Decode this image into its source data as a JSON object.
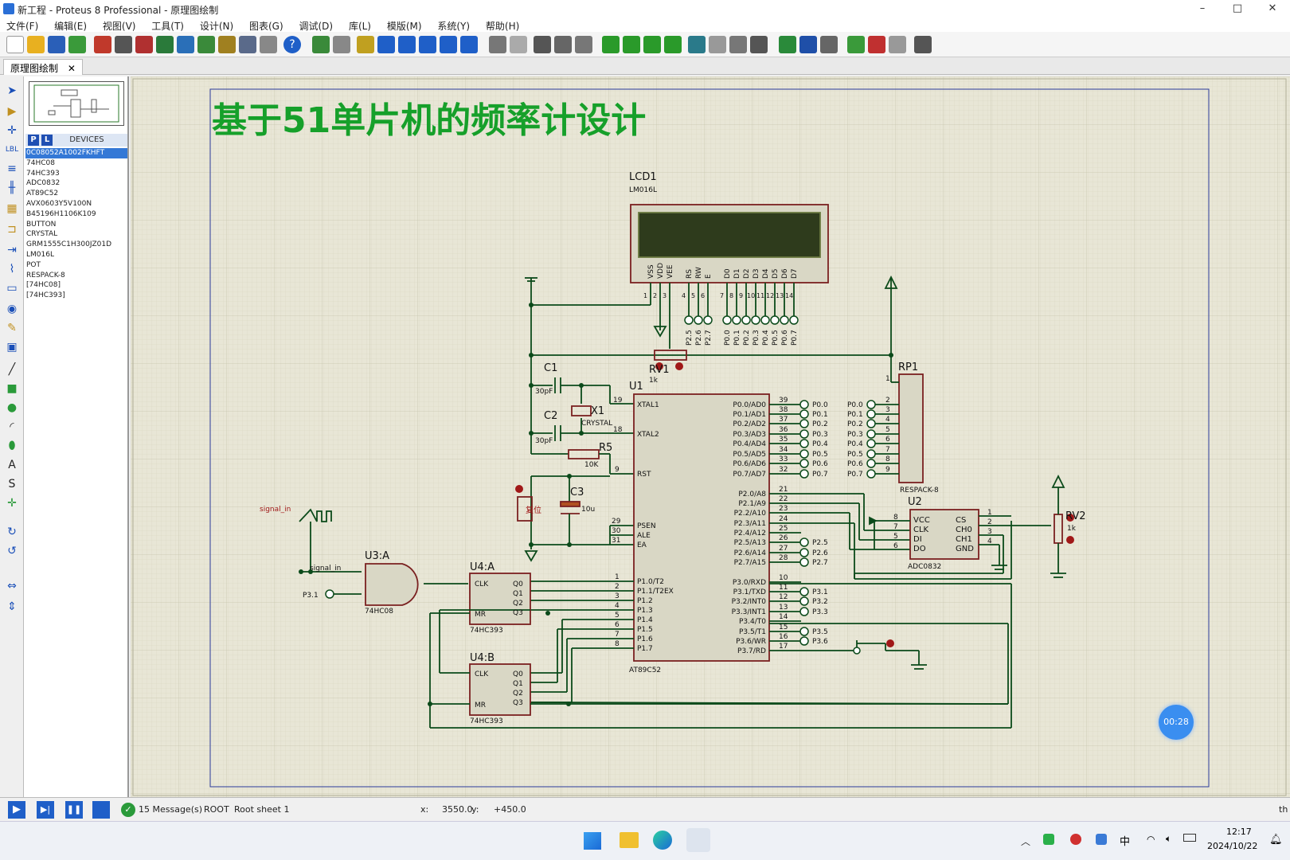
{
  "window": {
    "title": "新工程 - Proteus 8 Professional - 原理图绘制",
    "minimize": "–",
    "maximize": "□",
    "close": "✕"
  },
  "menu": [
    "文件(F)",
    "编辑(E)",
    "视图(V)",
    "工具(T)",
    "设计(N)",
    "图表(G)",
    "调试(D)",
    "库(L)",
    "模版(M)",
    "系统(Y)",
    "帮助(H)"
  ],
  "tab": {
    "label": "原理图绘制",
    "close": "✕"
  },
  "devices": {
    "header": "DEVICES",
    "p_button": "P",
    "l_button": "L",
    "items": [
      "0C08052A1002FKHFT",
      "74HC08",
      "74HC393",
      "ADC0832",
      "AT89C52",
      "AVX0603Y5V100N",
      "B45196H1106K109",
      "BUTTON",
      "CRYSTAL",
      "GRM1555C1H300JZ01D",
      "LM016L",
      "POT",
      "RESPACK-8",
      "[74HC08]",
      "[74HC393]"
    ],
    "selected_index": 0
  },
  "schematic": {
    "title": "基于51单片机的频率计设计",
    "lcd": {
      "ref": "LCD1",
      "part": "LM016L",
      "pins": [
        "VSS",
        "VDD",
        "VEE",
        "RS",
        "RW",
        "E",
        "D0",
        "D1",
        "D2",
        "D3",
        "D4",
        "D5",
        "D6",
        "D7"
      ],
      "pin_nums": [
        "1",
        "2",
        "3",
        "4",
        "5",
        "6",
        "7",
        "8",
        "9",
        "10",
        "11",
        "12",
        "13",
        "14"
      ],
      "labels": [
        "P2.5",
        "P2.6",
        "P2.7",
        "P0.0",
        "P0.1",
        "P0.2",
        "P0.3",
        "P0.4",
        "P0.5",
        "P0.6",
        "P0.7"
      ]
    },
    "rv1": {
      "ref": "RV1",
      "val": "1k"
    },
    "rv2": {
      "ref": "RV2",
      "val": "1k"
    },
    "c1": {
      "ref": "C1",
      "val": "30pF"
    },
    "c2": {
      "ref": "C2",
      "val": "30pF"
    },
    "c3": {
      "ref": "C3",
      "val": "10u"
    },
    "x1": {
      "ref": "X1",
      "part": "CRYSTAL"
    },
    "r5": {
      "ref": "R5",
      "val": "10K"
    },
    "reset_label": "复位",
    "u1": {
      "ref": "U1",
      "part": "AT89C52",
      "left_pins": [
        "XTAL1",
        "XTAL2",
        "RST",
        "PSEN",
        "ALE",
        "EA",
        "P1.0/T2",
        "P1.1/T2EX",
        "P1.2",
        "P1.3",
        "P1.4",
        "P1.5",
        "P1.6",
        "P1.7"
      ],
      "left_nums": [
        "19",
        "18",
        "9",
        "29",
        "30",
        "31",
        "1",
        "2",
        "3",
        "4",
        "5",
        "6",
        "7",
        "8"
      ],
      "right_pins": [
        "P0.0/AD0",
        "P0.1/AD1",
        "P0.2/AD2",
        "P0.3/AD3",
        "P0.4/AD4",
        "P0.5/AD5",
        "P0.6/AD6",
        "P0.7/AD7",
        "P2.0/A8",
        "P2.1/A9",
        "P2.2/A10",
        "P2.3/A11",
        "P2.4/A12",
        "P2.5/A13",
        "P2.6/A14",
        "P2.7/A15",
        "P3.0/RXD",
        "P3.1/TXD",
        "P3.2/INT0",
        "P3.3/INT1",
        "P3.4/T0",
        "P3.5/T1",
        "P3.6/WR",
        "P3.7/RD"
      ],
      "right_nums": [
        "39",
        "38",
        "37",
        "36",
        "35",
        "34",
        "33",
        "32",
        "21",
        "22",
        "23",
        "24",
        "25",
        "26",
        "27",
        "28",
        "10",
        "11",
        "12",
        "13",
        "14",
        "15",
        "16",
        "17"
      ],
      "port_labels": [
        "P0.0",
        "P0.1",
        "P0.2",
        "P0.3",
        "P0.4",
        "P0.5",
        "P0.6",
        "P0.7"
      ],
      "p2_labels": [
        "P2.5",
        "P2.6",
        "P2.7"
      ],
      "p3_labels": [
        "P3.1",
        "P3.2",
        "P3.3",
        "P3.5",
        "P3.6"
      ]
    },
    "rp1": {
      "ref": "RP1",
      "part": "RESPACK-8",
      "labels": [
        "P0.0",
        "P0.1",
        "P0.2",
        "P0.3",
        "P0.4",
        "P0.5",
        "P0.6",
        "P0.7"
      ],
      "nums": [
        "1",
        "2",
        "3",
        "4",
        "5",
        "6",
        "7",
        "8",
        "9"
      ]
    },
    "u2": {
      "ref": "U2",
      "part": "ADC0832",
      "left": [
        "VCC",
        "CLK",
        "DI",
        "DO"
      ],
      "right": [
        "CS",
        "CH0",
        "CH1",
        "GND"
      ],
      "left_nums": [
        "8",
        "7",
        "5",
        "6"
      ],
      "right_nums": [
        "1",
        "2",
        "3",
        "4"
      ]
    },
    "u3": {
      "ref": "U3:A",
      "part": "74HC08",
      "in_a": "signal_in",
      "in_b": "P3.1"
    },
    "u4a": {
      "ref": "U4:A",
      "part": "74HC393",
      "pins": [
        "CLK",
        "MR",
        "Q0",
        "Q1",
        "Q2",
        "Q3"
      ]
    },
    "u4b": {
      "ref": "U4:B",
      "part": "74HC393",
      "pins": [
        "CLK",
        "MR",
        "Q0",
        "Q1",
        "Q2",
        "Q3"
      ]
    },
    "signal_gen": "signal_in",
    "timer": "00:28"
  },
  "status": {
    "messages": "15 Message(s)",
    "root": "ROOT",
    "sheet": "Root sheet 1",
    "x_label": "x:",
    "x": "3550.0",
    "y_label": "y:",
    "y": "+450.0",
    "units": "th"
  },
  "taskbar": {
    "ime": "中",
    "time": "12:17",
    "date": "2024/10/22"
  },
  "colors": {
    "accent": "#1a4fb8",
    "wire": "#0b5a1a",
    "part": "#a02020",
    "title_green": "#16a02a"
  }
}
